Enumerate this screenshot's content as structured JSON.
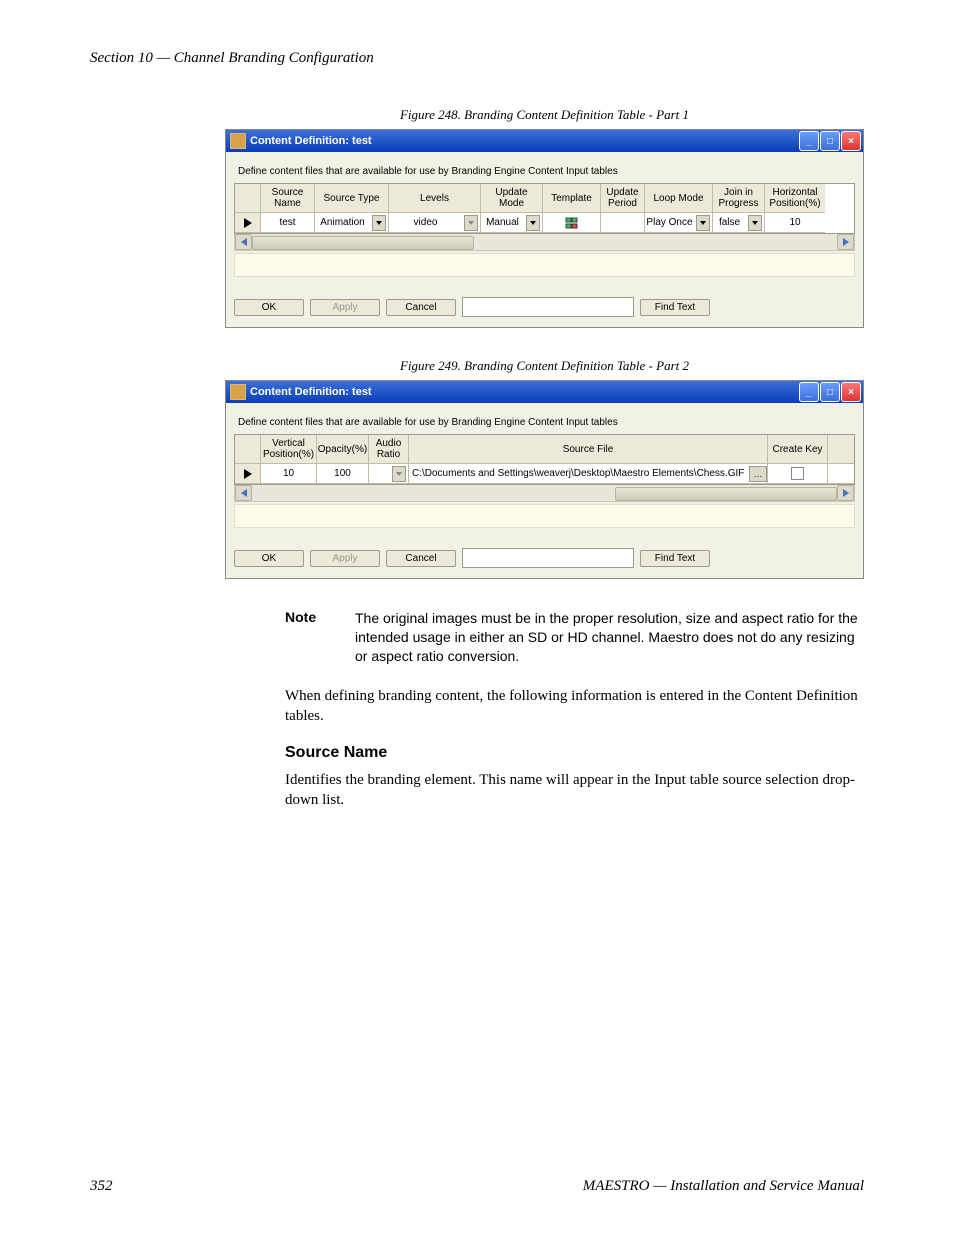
{
  "header": {
    "section": "Section 10 — Channel Branding Configuration"
  },
  "fig1": {
    "caption": "Figure 248.  Branding Content Definition Table - Part 1",
    "title": "Content Definition: test",
    "desc": "Define content files that are available for use by Branding Engine Content Input tables",
    "cols": [
      "Source Name",
      "Source Type",
      "Levels",
      "Update Mode",
      "Template",
      "Update Period",
      "Loop Mode",
      "Join in Progress",
      "Horizontal Position(%)"
    ],
    "row": {
      "source_name": "test",
      "source_type": "Animation",
      "levels": "video",
      "update_mode": "Manual",
      "template": "icon",
      "update_period": "",
      "loop_mode": "Play Once",
      "join_in_progress": "false",
      "hpos": "10"
    }
  },
  "fig2": {
    "caption": "Figure 249.  Branding Content Definition Table - Part 2",
    "title": "Content Definition: test",
    "desc": "Define content files that are available for use by Branding Engine Content Input tables",
    "cols": [
      "Vertical Position(%)",
      "Opacity(%)",
      "Audio Ratio",
      "Source File",
      "Create Key"
    ],
    "row": {
      "vpos": "10",
      "opacity": "100",
      "audio_ratio": "",
      "source_file": "C:\\Documents and Settings\\weaverj\\Desktop\\Maestro Elements\\Chess.GIF",
      "create_key": "unchecked"
    }
  },
  "buttons": {
    "ok": "OK",
    "apply": "Apply",
    "cancel": "Cancel",
    "find": "Find Text"
  },
  "note": {
    "label": "Note",
    "body": "The original images must be in the proper resolution, size and aspect ratio for the intended usage in either an SD or HD channel. Maestro does not do any resizing or aspect ratio conversion."
  },
  "para1": "When defining branding content, the following information is entered in the Content Definition tables.",
  "h_source_name": "Source Name",
  "para2": "Identifies the branding element. This name will appear in the Input table source selection drop-down list.",
  "footer": {
    "page": "352",
    "title": "MAESTRO  —  Installation and Service Manual"
  }
}
